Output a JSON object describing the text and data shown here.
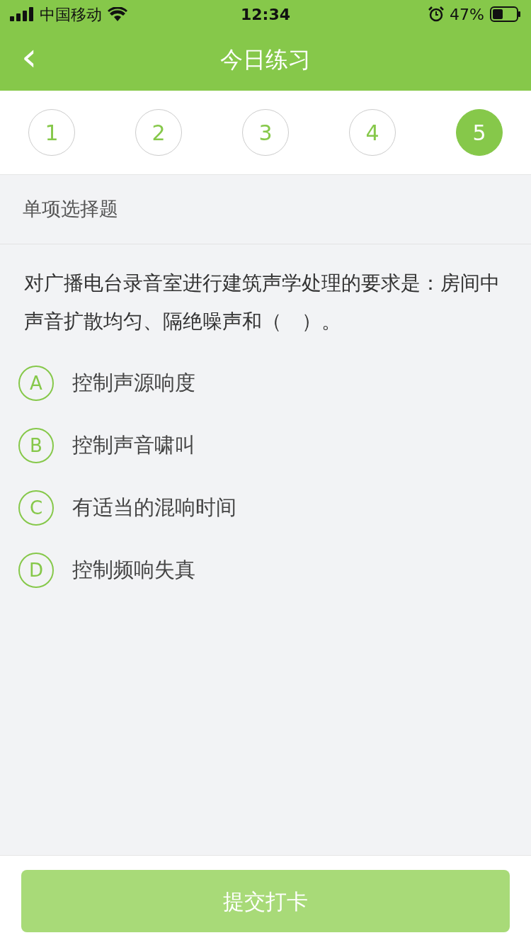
{
  "status_bar": {
    "carrier": "中国移动",
    "time": "12:34",
    "battery": "47%"
  },
  "nav": {
    "back_icon": "‹",
    "title": "今日练习"
  },
  "steps": [
    {
      "label": "1",
      "selected": false
    },
    {
      "label": "2",
      "selected": false
    },
    {
      "label": "3",
      "selected": false
    },
    {
      "label": "4",
      "selected": false
    },
    {
      "label": "5",
      "selected": true
    }
  ],
  "question": {
    "type": "单项选择题",
    "text": "对广播电台录音室进行建筑声学处理的要求是：房间中声音扩散均匀、隔绝噪声和（　）。",
    "options": [
      {
        "letter": "A",
        "text": "控制声源响度",
        "selected": false
      },
      {
        "letter": "B",
        "text": "控制声音啸叫",
        "selected": false
      },
      {
        "letter": "C",
        "text": "有适当的混响时间",
        "selected": false
      },
      {
        "letter": "D",
        "text": "控制频响失真",
        "selected": false
      }
    ]
  },
  "submit": {
    "label": "提交打卡",
    "disabled": true
  }
}
